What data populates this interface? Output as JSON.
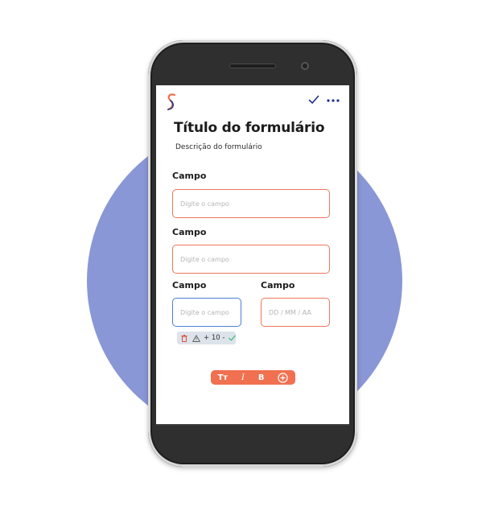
{
  "form": {
    "title": "Título do formulário",
    "description": "Descrição do formulário"
  },
  "fields": [
    {
      "label": "Campo",
      "placeholder": "Digite o campo"
    },
    {
      "label": "Campo",
      "placeholder": "Digite o campo"
    },
    {
      "label": "Campo",
      "placeholder": "Digite o campo"
    },
    {
      "label": "Campo",
      "placeholder": "DD / MM / AA"
    }
  ],
  "field_toolbar": {
    "counter": "+ 10 -"
  },
  "format_bar": {
    "text_size": "Tт",
    "italic": "I",
    "bold": "B"
  },
  "icons": {
    "header_right": [
      "check-icon",
      "more-icon"
    ],
    "field_toolbar": [
      "trash-icon",
      "warning-icon",
      "check-icon"
    ],
    "format_bar": [
      "text-size-icon",
      "italic-icon",
      "bold-icon",
      "add-circle-icon"
    ]
  },
  "colors": {
    "accent": "#f0765a",
    "active_field": "#4d7ed8",
    "brand_blue": "#1f2e8a",
    "background_circle": "#8a97d6",
    "success": "#3cbf7a"
  }
}
